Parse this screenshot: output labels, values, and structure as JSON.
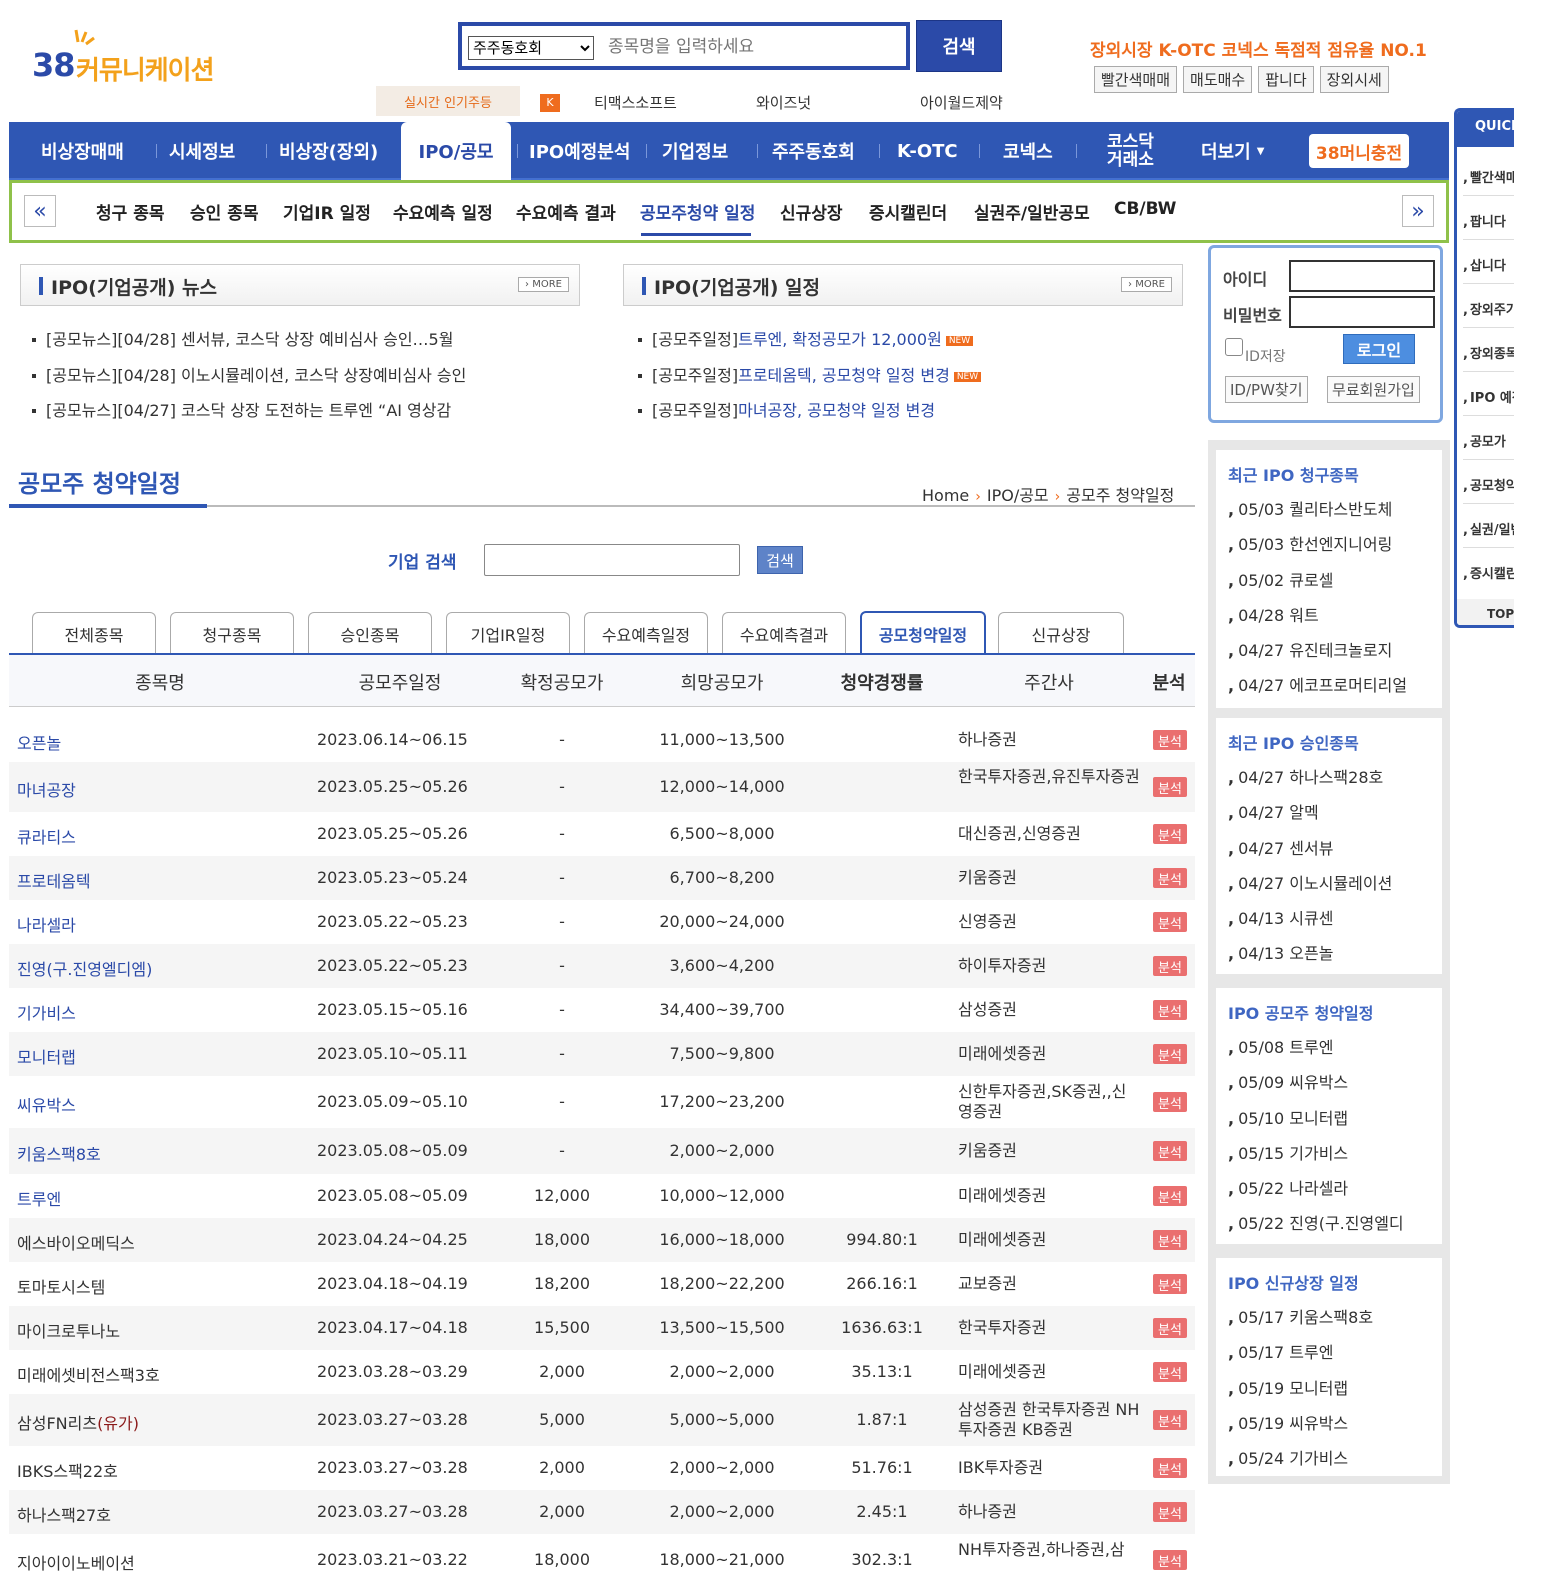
{
  "logo": {
    "number": "38",
    "text": "커뮤니케이션"
  },
  "search": {
    "select_value": "주주동호회",
    "placeholder": "종목명을 입력하세요",
    "button": "검색"
  },
  "promo": {
    "text_prefix": "장외시장 K-OTC 코넥스 ",
    "text_bold": "독점적 점유율 NO.1",
    "buttons": [
      "빨간색매매",
      "매도매수",
      "팝니다",
      "장외시세"
    ]
  },
  "hot": {
    "label": "실시간 인기주등",
    "badge": "K",
    "items": [
      "티맥스소프트",
      "와이즈넛",
      "아이월드제약"
    ]
  },
  "gnb": {
    "items": [
      "비상장매매",
      "시세정보",
      "비상장(장외)",
      "IPO/공모",
      "IPO예정분석",
      "기업정보",
      "주주동호회",
      "K-OTC",
      "코넥스",
      "코스닥 거래소",
      "더보기",
      "38머니충전"
    ],
    "more_icon": "caret-down-icon"
  },
  "subnav": {
    "items": [
      "청구 종목",
      "승인 종목",
      "기업IR 일정",
      "수요예측 일정",
      "수요예측 결과",
      "공모주청약 일정",
      "신규상장",
      "증시캘린더",
      "실권주/일반공모",
      "CB/BW"
    ],
    "prev": "«",
    "next": "»"
  },
  "news": {
    "title": "IPO(기업공개) 뉴스",
    "more": "› MORE",
    "items": [
      "[공모뉴스][04/28] 센서뷰, 코스닥 상장 예비심사 승인…5월",
      "[공모뉴스][04/28] 이노시뮬레이션, 코스닥 상장예비심사 승인",
      "[공모뉴스][04/27] 코스닥 상장 도전하는 트루엔 “AI 영상감"
    ]
  },
  "schedule": {
    "title": "IPO(기업공개) 일정",
    "more": "› MORE",
    "prefix": "[공모주일정]",
    "items": [
      "트루엔, 확정공모가 12,000원",
      "프로테옴텍, 공모청약 일정 변경",
      "마녀공장, 공모청약 일정 변경"
    ],
    "new_badge": "NEW"
  },
  "page": {
    "title": "공모주 청약일정",
    "breadcrumb": [
      "Home",
      "IPO/공모",
      "공모주 청약일정"
    ],
    "breadcrumb_sep": "›"
  },
  "company_search": {
    "label": "기업 검색",
    "button": "검색"
  },
  "tabs": [
    "전체종목",
    "청구종목",
    "승인종목",
    "기업IR일정",
    "수요예측일정",
    "수요예측결과",
    "공모청약일정",
    "신규상장"
  ],
  "table": {
    "headers": [
      "종목명",
      "공모주일정",
      "확정공모가",
      "희망공모가",
      "청약경쟁률",
      "주간사",
      "분석"
    ],
    "analysis_label": "분석",
    "rows": [
      {
        "name": "오픈놀",
        "date": "2023.06.14~06.15",
        "fixed": "-",
        "hope": "11,000~13,500",
        "rate": "",
        "underwriter": "하나증권"
      },
      {
        "name": "마녀공장",
        "date": "2023.05.25~05.26",
        "fixed": "-",
        "hope": "12,000~14,000",
        "rate": "",
        "underwriter": "한국투자증권,유진투자증권"
      },
      {
        "name": "큐라티스",
        "date": "2023.05.25~05.26",
        "fixed": "-",
        "hope": "6,500~8,000",
        "rate": "",
        "underwriter": "대신증권,신영증권"
      },
      {
        "name": "프로테옴텍",
        "date": "2023.05.23~05.24",
        "fixed": "-",
        "hope": "6,700~8,200",
        "rate": "",
        "underwriter": "키움증권"
      },
      {
        "name": "나라셀라",
        "date": "2023.05.22~05.23",
        "fixed": "-",
        "hope": "20,000~24,000",
        "rate": "",
        "underwriter": "신영증권"
      },
      {
        "name": "진영(구.진영엘디엠)",
        "date": "2023.05.22~05.23",
        "fixed": "-",
        "hope": "3,600~4,200",
        "rate": "",
        "underwriter": "하이투자증권"
      },
      {
        "name": "기가비스",
        "date": "2023.05.15~05.16",
        "fixed": "-",
        "hope": "34,400~39,700",
        "rate": "",
        "underwriter": "삼성증권"
      },
      {
        "name": "모니터랩",
        "date": "2023.05.10~05.11",
        "fixed": "-",
        "hope": "7,500~9,800",
        "rate": "",
        "underwriter": "미래에셋증권"
      },
      {
        "name": "씨유박스",
        "date": "2023.05.09~05.10",
        "fixed": "-",
        "hope": "17,200~23,200",
        "rate": "",
        "underwriter": "신한투자증권,SK증권,,신영증권"
      },
      {
        "name": "키움스팩8호",
        "date": "2023.05.08~05.09",
        "fixed": "-",
        "hope": "2,000~2,000",
        "rate": "",
        "underwriter": "키움증권"
      },
      {
        "name": "트루엔",
        "date": "2023.05.08~05.09",
        "fixed": "12,000",
        "hope": "10,000~12,000",
        "rate": "",
        "underwriter": "미래에셋증권"
      },
      {
        "name": "에스바이오메딕스",
        "date": "2023.04.24~04.25",
        "fixed": "18,000",
        "hope": "16,000~18,000",
        "rate": "994.80:1",
        "underwriter": "미래에셋증권"
      },
      {
        "name": "토마토시스템",
        "date": "2023.04.18~04.19",
        "fixed": "18,200",
        "hope": "18,200~22,200",
        "rate": "266.16:1",
        "underwriter": "교보증권"
      },
      {
        "name": "마이크로투나노",
        "date": "2023.04.17~04.18",
        "fixed": "15,500",
        "hope": "13,500~15,500",
        "rate": "1636.63:1",
        "underwriter": "한국투자증권"
      },
      {
        "name": "미래에셋비전스팩3호",
        "date": "2023.03.28~03.29",
        "fixed": "2,000",
        "hope": "2,000~2,000",
        "rate": "35.13:1",
        "underwriter": "미래에셋증권"
      },
      {
        "name": "삼성FN리츠",
        "name_suffix": "(유가)",
        "date": "2023.03.27~03.28",
        "fixed": "5,000",
        "hope": "5,000~5,000",
        "rate": "1.87:1",
        "underwriter": "삼성증권 한국투자증권 NH투자증권 KB증권"
      },
      {
        "name": "IBKS스팩22호",
        "date": "2023.03.27~03.28",
        "fixed": "2,000",
        "hope": "2,000~2,000",
        "rate": "51.76:1",
        "underwriter": "IBK투자증권"
      },
      {
        "name": "하나스팩27호",
        "date": "2023.03.27~03.28",
        "fixed": "2,000",
        "hope": "2,000~2,000",
        "rate": "2.45:1",
        "underwriter": "하나증권"
      },
      {
        "name": "지아이이노베이션",
        "date": "2023.03.21~03.22",
        "fixed": "18,000",
        "hope": "18,000~21,000",
        "rate": "302.3:1",
        "underwriter": "NH투자증권,하나증권,삼"
      }
    ]
  },
  "login": {
    "id_label": "아이디",
    "pw_label": "비밀번호",
    "save_label": "ID저장",
    "login_button": "로그인",
    "find": "ID/PW찾기",
    "join": "무료회원가입"
  },
  "sidebar": {
    "claim": {
      "title": "최근 IPO 청구종목",
      "items": [
        "05/03 퀄리타스반도체",
        "05/03 한선엔지니어링",
        "05/02 큐로셀",
        "04/28 워트",
        "04/27 유진테크놀로지",
        "04/27 에코프로머티리얼"
      ]
    },
    "approve": {
      "title": "최근 IPO 승인종목",
      "items": [
        "04/27 하나스팩28호",
        "04/27 알멕",
        "04/27 센서뷰",
        "04/27 이노시뮬레이션",
        "04/13 시큐센",
        "04/13 오픈놀"
      ]
    },
    "subscribe": {
      "title": "IPO 공모주 청약일정",
      "items": [
        "05/08 트루엔",
        "05/09 씨유박스",
        "05/10 모니터랩",
        "05/15 기가비스",
        "05/22 나라셀라",
        "05/22 진영(구.진영엘디"
      ]
    },
    "listing": {
      "title": "IPO 신규상장 일정",
      "items": [
        "05/17 키움스팩8호",
        "05/17 트루엔",
        "05/19 모니터랩",
        "05/19 씨유박스",
        "05/24 기가비스"
      ]
    }
  },
  "quick": {
    "title": "QUICK",
    "items": [
      "빨간색매매",
      "팝니다",
      "삽니다",
      "장외주가",
      "장외종목",
      "IPO 예정",
      "공모가",
      "공모청약",
      "실권/일반",
      "증시캘린더"
    ],
    "top": "TOP"
  }
}
